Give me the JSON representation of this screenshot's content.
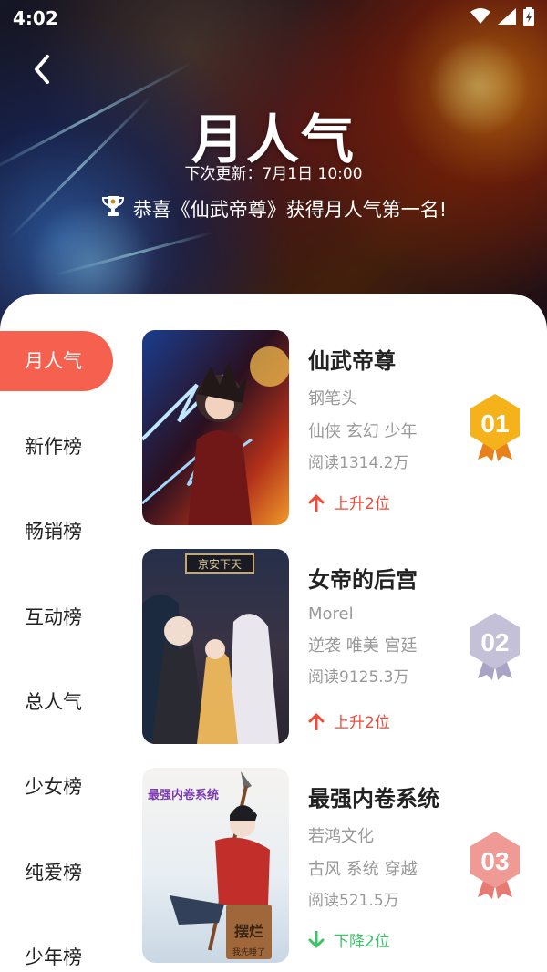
{
  "status_bar": {
    "time": "4:02",
    "icons": [
      "wifi-icon",
      "signal-icon",
      "battery-charging-icon"
    ]
  },
  "header": {
    "title": "月人气",
    "next_update": "下次更新：7月1日 10:00",
    "congrats": "恭喜《仙武帝尊》获得月人气第一名!"
  },
  "sidebar": {
    "items": [
      {
        "label": "月人气",
        "active": true
      },
      {
        "label": "新作榜"
      },
      {
        "label": "畅销榜"
      },
      {
        "label": "互动榜"
      },
      {
        "label": "总人气"
      },
      {
        "label": "少女榜"
      },
      {
        "label": "纯爱榜"
      },
      {
        "label": "少年榜"
      }
    ]
  },
  "ranking": [
    {
      "rank": "01",
      "title": "仙武帝尊",
      "author": "钢笔头",
      "tags": "仙侠 玄幻 少年",
      "reads": "阅读1314.2万",
      "trend": "上升2位",
      "direction": "up",
      "badge_color": "#f5b21b"
    },
    {
      "rank": "02",
      "title": "女帝的后宫",
      "author": "Morel",
      "tags": "逆袭 唯美 宫廷",
      "reads": "阅读9125.3万",
      "trend": "上升2位",
      "direction": "up",
      "badge_color": "#c4c0d8"
    },
    {
      "rank": "03",
      "title": "最强内卷系统",
      "author": "若鸿文化",
      "tags": "古风 系统 穿越",
      "reads": "阅读521.5万",
      "trend": "下降2位",
      "direction": "down",
      "badge_color": "#ef9a94"
    }
  ],
  "colors": {
    "accent": "#f6604e",
    "up": "#ef4b3a",
    "down": "#3cc36a",
    "muted": "#999999"
  },
  "cover_art": {
    "cover_2_sign": "京安下天",
    "cover_3_title": "最强内卷系统",
    "cover_3_sign": "摆烂",
    "cover_3_note": "我先睡了"
  }
}
